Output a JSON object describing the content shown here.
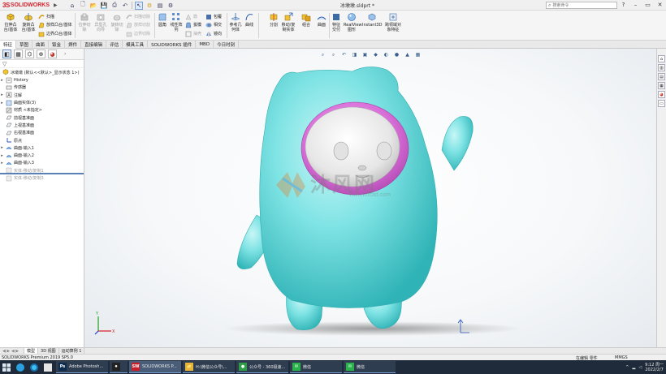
{
  "app": {
    "brand_ds": "3S",
    "brand_name": "SOLIDWORKS",
    "doc_title": "冰墩墩.sldprt *",
    "search_placeholder": "搜索命令"
  },
  "ribbon": {
    "extrude_boss": "拉伸凸台/基体",
    "revolve_boss": "旋转凸台/基体",
    "sweep": "扫描",
    "loft_boss": "放样凸台/基体",
    "boundary_boss": "边界凸台/基体",
    "extrude_cut": "拉伸切除",
    "hole_wizard": "异型孔向导",
    "revolve_cut": "旋转切除",
    "swept_cut": "扫描切除",
    "lofted_cut": "放样切割",
    "boundary_cut": "边界切除",
    "fillet": "圆角",
    "linear_pattern": "线性阵列",
    "rib": "筋",
    "draft": "拔模",
    "shell": "抽壳",
    "wrap": "包覆",
    "intersect": "相交",
    "mirror": "镜向",
    "ref_geometry": "参考几何体",
    "curves": "曲线",
    "split": "分割",
    "move_copy": "移动/复制实体",
    "combine": "组合",
    "curve_driven": "曲面",
    "realview": "RealView 图形",
    "instant3d": "Instant3D",
    "cert": "特征交付",
    "features_doc": "跨领域对象特征"
  },
  "command_tabs": [
    "特征",
    "草图",
    "曲面",
    "钣金",
    "焊件",
    "直接编辑",
    "评估",
    "模具工具",
    "SOLIDWORKS 插件",
    "MBD",
    "今日时刻"
  ],
  "feature_tree": {
    "root": "冰墩墩 (默认<<默认>_显示状态 1>)",
    "items": [
      {
        "label": "History",
        "grey": false,
        "expand": "▸"
      },
      {
        "label": "传感器",
        "grey": false,
        "expand": ""
      },
      {
        "label": "注解",
        "grey": false,
        "expand": "▸"
      },
      {
        "label": "曲面实体(3)",
        "grey": false,
        "expand": "▸"
      },
      {
        "label": "材质 <未指定>",
        "grey": false,
        "expand": ""
      },
      {
        "label": "前视基准面",
        "grey": false,
        "expand": ""
      },
      {
        "label": "上视基准面",
        "grey": false,
        "expand": ""
      },
      {
        "label": "右视基准面",
        "grey": false,
        "expand": ""
      },
      {
        "label": "原点",
        "grey": false,
        "expand": ""
      },
      {
        "label": "曲面-输入1",
        "grey": false,
        "expand": "▸"
      },
      {
        "label": "曲面-输入2",
        "grey": false,
        "expand": "▸"
      },
      {
        "label": "曲面-输入3",
        "grey": false,
        "expand": "▸"
      },
      {
        "label": "实体-移动/复制1",
        "grey": true,
        "expand": ""
      },
      {
        "label": "实体-移动/复制3",
        "grey": true,
        "expand": ""
      }
    ]
  },
  "bottom_tabs": [
    "模型",
    "3D 视图",
    "运动算例 1"
  ],
  "status": {
    "version": "SOLIDWORKS Premium 2019 SP5.0",
    "editing": "在编辑 零件",
    "units": "MMGS"
  },
  "watermark": {
    "text": "沐风网",
    "url": "www.mfcad.com"
  },
  "taskbar": {
    "apps": [
      {
        "label": "Adobe Photosh...",
        "icon": "Ps",
        "color": "#0b2c4f"
      },
      {
        "label": "",
        "icon": "⏺",
        "color": "#222"
      },
      {
        "label": "SOLIDWORKS P...",
        "icon": "SW",
        "color": "#c8202b"
      },
      {
        "label": "H:\\微信公众号\\...",
        "icon": "📁",
        "color": "#e7b53c"
      },
      {
        "label": "公众号 - 360极速...",
        "icon": "●",
        "color": "#2e9b46"
      },
      {
        "label": "微信",
        "icon": "✉",
        "color": "#29b34a"
      },
      {
        "label": "微信",
        "icon": "✉",
        "color": "#29b34a"
      }
    ],
    "time": "9:12 周一",
    "date": "2022/2/7"
  },
  "colors": {
    "body_cyan": "#7fe3e4",
    "ring_pink": "#d96fd9",
    "face_white": "#eeeeee",
    "brand_red": "#d3202b"
  }
}
